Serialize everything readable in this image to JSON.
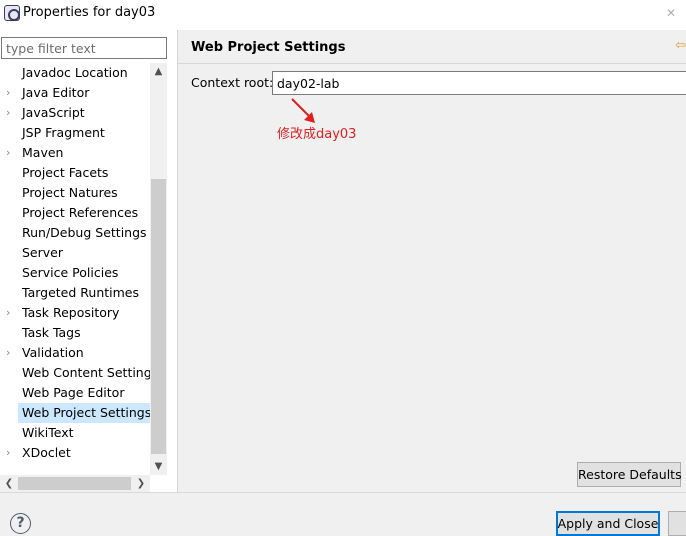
{
  "window": {
    "title": "Properties for day03",
    "icon": "eclipse-properties-icon",
    "close_glyph": "✕"
  },
  "filter": {
    "placeholder": "type filter text",
    "value": ""
  },
  "tree": {
    "items": [
      {
        "label": "Javadoc Location",
        "expandable": false,
        "selected": false
      },
      {
        "label": "Java Editor",
        "expandable": true,
        "selected": false
      },
      {
        "label": "JavaScript",
        "expandable": true,
        "selected": false
      },
      {
        "label": "JSP Fragment",
        "expandable": false,
        "selected": false
      },
      {
        "label": "Maven",
        "expandable": true,
        "selected": false
      },
      {
        "label": "Project Facets",
        "expandable": false,
        "selected": false
      },
      {
        "label": "Project Natures",
        "expandable": false,
        "selected": false
      },
      {
        "label": "Project References",
        "expandable": false,
        "selected": false
      },
      {
        "label": "Run/Debug Settings",
        "expandable": false,
        "selected": false
      },
      {
        "label": "Server",
        "expandable": false,
        "selected": false
      },
      {
        "label": "Service Policies",
        "expandable": false,
        "selected": false
      },
      {
        "label": "Targeted Runtimes",
        "expandable": false,
        "selected": false
      },
      {
        "label": "Task Repository",
        "expandable": true,
        "selected": false
      },
      {
        "label": "Task Tags",
        "expandable": false,
        "selected": false
      },
      {
        "label": "Validation",
        "expandable": true,
        "selected": false
      },
      {
        "label": "Web Content Settings",
        "expandable": false,
        "selected": false
      },
      {
        "label": "Web Page Editor",
        "expandable": false,
        "selected": false
      },
      {
        "label": "Web Project Settings",
        "expandable": false,
        "selected": true
      },
      {
        "label": "WikiText",
        "expandable": false,
        "selected": false
      },
      {
        "label": "XDoclet",
        "expandable": true,
        "selected": false
      }
    ],
    "expand_glyph": "›"
  },
  "page": {
    "title": "Web Project Settings",
    "context_root_label": "Context root:",
    "context_root_value": "day02-lab",
    "annotation_text": "修改成day03",
    "annotation_color": "#e02020",
    "nav_glyph": "⇦"
  },
  "buttons": {
    "restore_defaults": "Restore Defaults",
    "apply_and_close": "Apply and Close"
  },
  "colors": {
    "selection": "#cce8ff",
    "accent": "#0078d7",
    "panel_bg": "#f0f0f0"
  }
}
